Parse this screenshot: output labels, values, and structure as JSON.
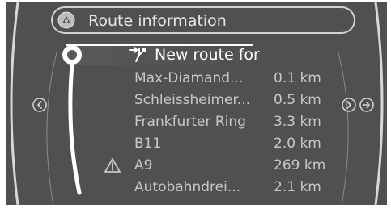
{
  "header": {
    "title": "Route information",
    "icon": "route-info-icon"
  },
  "destination": {
    "label": "New route for",
    "icon": "route-fork-icon"
  },
  "route_segments": [
    {
      "name": "Max-Diamand...",
      "distance": "0.1 km",
      "warning": false
    },
    {
      "name": "Schleissheimer...",
      "distance": "0.5 km",
      "warning": false
    },
    {
      "name": "Frankfurter Ring",
      "distance": "3.3 km",
      "warning": false
    },
    {
      "name": "B11",
      "distance": "2.0 km",
      "warning": false
    },
    {
      "name": "A9",
      "distance": "269 km",
      "warning": true
    },
    {
      "name": "Autobahndrei...",
      "distance": "2.1 km",
      "warning": false
    }
  ],
  "nav": {
    "left_icon": "chevron-left-icon",
    "right_icon": "chevron-right-icon",
    "extra_icon": "next-page-icon"
  },
  "colors": {
    "background": "#505050",
    "text": "#c8c8c8",
    "highlight": "#ffffff"
  }
}
